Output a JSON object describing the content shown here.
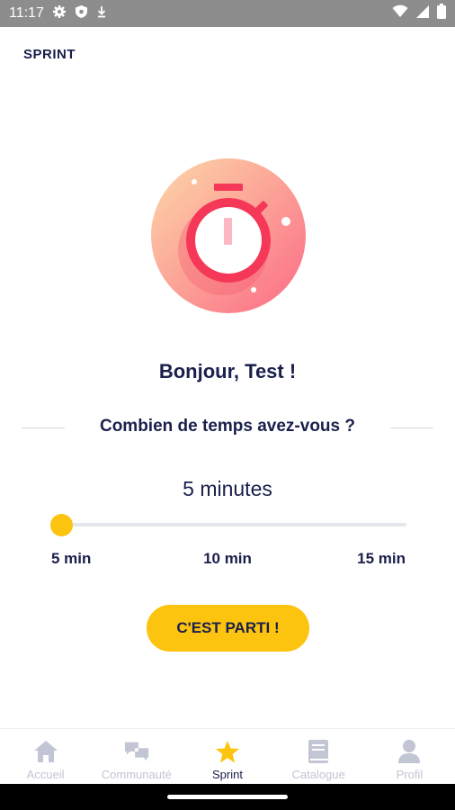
{
  "status_bar": {
    "time": "11:17",
    "icons": [
      "settings-icon",
      "shield-icon",
      "download-icon",
      "wifi-icon",
      "signal-icon",
      "battery-icon"
    ]
  },
  "header": {
    "title": "SPRINT"
  },
  "hero": {
    "icon": "stopwatch-icon",
    "colors": {
      "circle_start": "#fcd1a5",
      "circle_end": "#fc6f86",
      "stopwatch": "#f53858"
    }
  },
  "greeting": "Bonjour, Test !",
  "question": "Combien de temps avez-vous ?",
  "duration": {
    "value_label": "5 minutes",
    "selected_minutes": 5,
    "min": 5,
    "max": 15,
    "ticks": [
      "5 min",
      "10 min",
      "15 min"
    ]
  },
  "start_button": {
    "label": "C'EST PARTI !"
  },
  "bottom_nav": {
    "items": [
      {
        "label": "Accueil",
        "icon": "home-icon",
        "active": false
      },
      {
        "label": "Communauté",
        "icon": "chat-bubbles-icon",
        "active": false
      },
      {
        "label": "Sprint",
        "icon": "star-icon",
        "active": true
      },
      {
        "label": "Catalogue",
        "icon": "book-icon",
        "active": false
      },
      {
        "label": "Profil",
        "icon": "person-icon",
        "active": false
      }
    ]
  },
  "colors": {
    "accent": "#fcc30f",
    "text": "#1a1f4b",
    "inactive": "#c2c5d3"
  }
}
